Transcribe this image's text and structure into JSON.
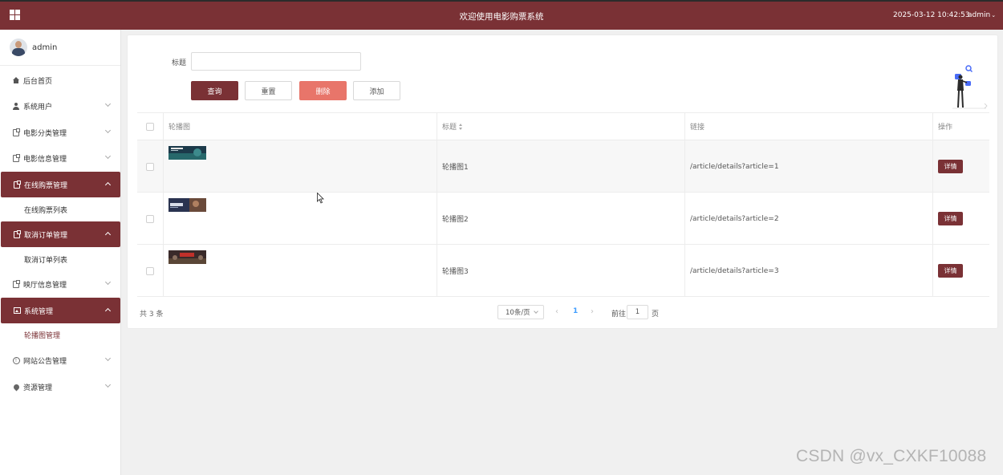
{
  "header": {
    "title": "欢迎使用电影购票系统",
    "datetime": "2025-03-12 10:42:53",
    "user": "admin"
  },
  "sidebar": {
    "profile_name": "admin",
    "items": [
      {
        "label": "后台首页",
        "icon": "home-icon"
      },
      {
        "label": "系统用户",
        "icon": "user-icon"
      },
      {
        "label": "电影分类管理",
        "icon": "document-icon"
      },
      {
        "label": "电影信息管理",
        "icon": "document-icon"
      },
      {
        "label": "在线购票管理",
        "icon": "document-icon",
        "sub": "在线购票列表"
      },
      {
        "label": "取消订单管理",
        "icon": "document-icon",
        "sub": "取消订单列表"
      },
      {
        "label": "映厅信息管理",
        "icon": "document-icon"
      },
      {
        "label": "系统管理",
        "icon": "picture-icon",
        "sub": "轮播图管理"
      },
      {
        "label": "网站公告管理",
        "icon": "info-icon"
      },
      {
        "label": "资源管理",
        "icon": "location-icon"
      }
    ]
  },
  "search": {
    "label": "标题",
    "value": "",
    "placeholder": ""
  },
  "buttons": {
    "query": "查询",
    "reset": "重置",
    "delete": "删除",
    "add": "添加"
  },
  "table": {
    "columns": [
      "轮播图",
      "标题",
      "链接",
      "操作"
    ],
    "rows": [
      {
        "title": "轮播图1",
        "link": "/article/details?article=1",
        "action": "详情"
      },
      {
        "title": "轮播图2",
        "link": "/article/details?article=2",
        "action": "详情"
      },
      {
        "title": "轮播图3",
        "link": "/article/details?article=3",
        "action": "详情"
      }
    ]
  },
  "pagination": {
    "total": "共 3 条",
    "page_size": "10条/页",
    "current_page": "1",
    "goto_label": "前往",
    "goto_value": "1",
    "page_unit": "页"
  },
  "watermark": "CSDN @vx_CXKF10088",
  "colors": {
    "brand": "#7a3135",
    "danger": "#e8756a",
    "link": "#409eff"
  }
}
